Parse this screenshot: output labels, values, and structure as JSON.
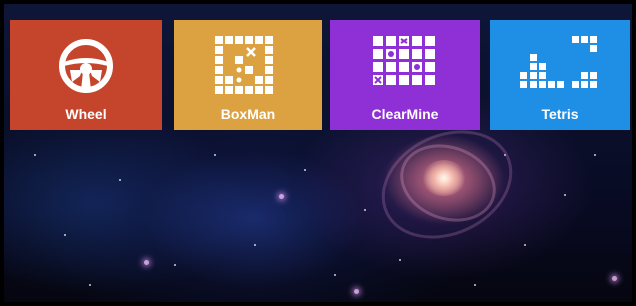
{
  "tiles": [
    {
      "label": "Wheel",
      "icon": "steering-wheel-icon",
      "color": "#c4452c"
    },
    {
      "label": "BoxMan",
      "icon": "boxman-grid-icon",
      "color": "#dca140"
    },
    {
      "label": "ClearMine",
      "icon": "minesweeper-grid-icon",
      "color": "#8f2fd6"
    },
    {
      "label": "Tetris",
      "icon": "tetris-blocks-icon",
      "color": "#1f8fe6"
    }
  ],
  "background": {
    "theme": "space-galaxy"
  }
}
